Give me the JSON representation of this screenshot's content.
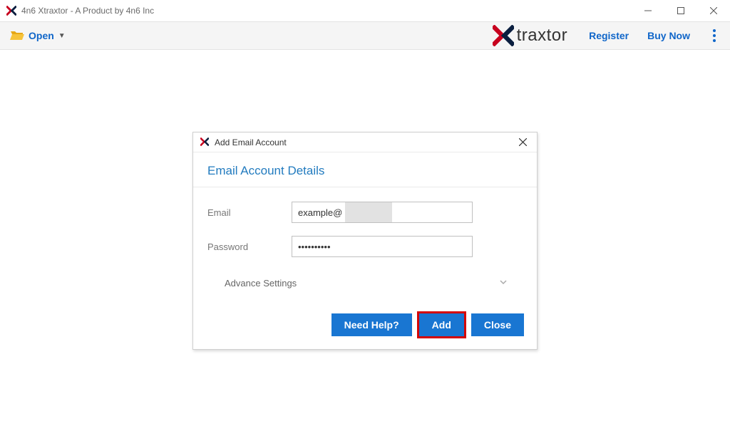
{
  "window": {
    "title": "4n6 Xtraxtor - A Product by 4n6 Inc"
  },
  "toolbar": {
    "open_label": "Open",
    "brand_text": "traxtor",
    "register_label": "Register",
    "buy_now_label": "Buy Now"
  },
  "modal": {
    "title": "Add Email Account",
    "section_title": "Email Account Details",
    "email_label": "Email",
    "email_value": "example@",
    "password_label": "Password",
    "password_value": "••••••••••",
    "advance_label": "Advance Settings",
    "need_help_label": "Need Help?",
    "add_label": "Add",
    "close_label": "Close"
  }
}
